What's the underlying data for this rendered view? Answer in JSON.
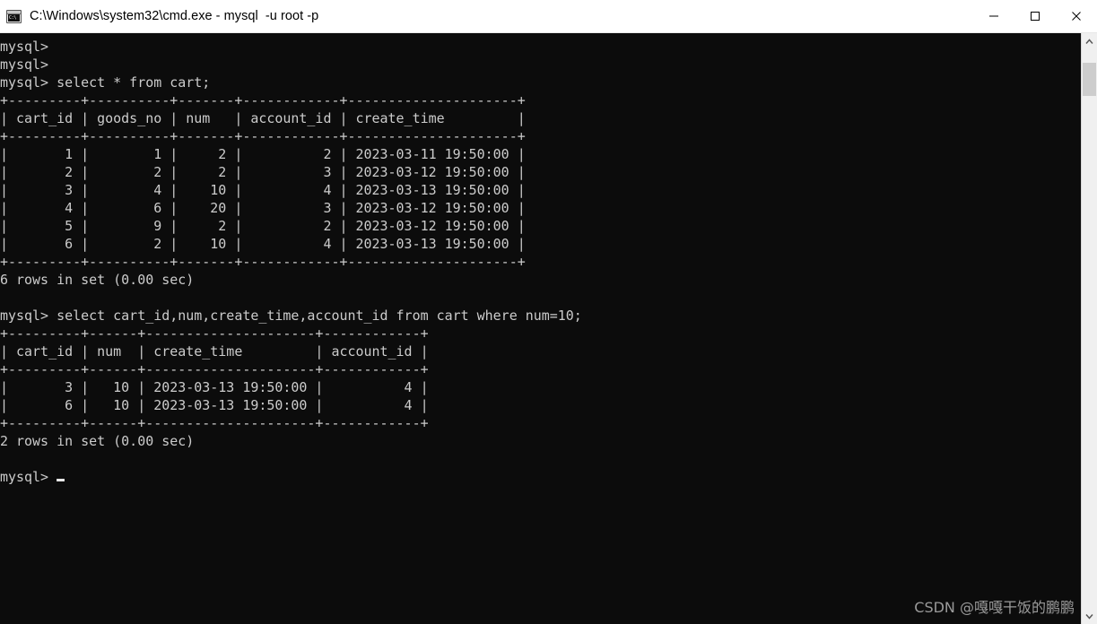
{
  "window": {
    "title": "C:\\Windows\\system32\\cmd.exe - mysql  -u root -p",
    "icon": "cmd-console-icon",
    "icon_text": "C:\\",
    "controls": {
      "minimize_label": "Minimize",
      "maximize_label": "Maximize",
      "close_label": "Close"
    }
  },
  "terminal": {
    "prompt": "mysql>",
    "background_color": "#0c0c0c",
    "text_color": "#cccccc",
    "lines": [
      "mysql>",
      "mysql>",
      "mysql> select * from cart;",
      "+---------+----------+-------+------------+---------------------+",
      "| cart_id | goods_no | num   | account_id | create_time         |",
      "+---------+----------+-------+------------+---------------------+",
      "|       1 |        1 |     2 |          2 | 2023-03-11 19:50:00 |",
      "|       2 |        2 |     2 |          3 | 2023-03-12 19:50:00 |",
      "|       3 |        4 |    10 |          4 | 2023-03-13 19:50:00 |",
      "|       4 |        6 |    20 |          3 | 2023-03-12 19:50:00 |",
      "|       5 |        9 |     2 |          2 | 2023-03-12 19:50:00 |",
      "|       6 |        2 |    10 |          4 | 2023-03-13 19:50:00 |",
      "+---------+----------+-------+------------+---------------------+",
      "6 rows in set (0.00 sec)",
      "",
      "mysql> select cart_id,num,create_time,account_id from cart where num=10;",
      "+---------+------+---------------------+------------+",
      "| cart_id | num  | create_time         | account_id |",
      "+---------+------+---------------------+------------+",
      "|       3 |   10 | 2023-03-13 19:50:00 |          4 |",
      "|       6 |   10 | 2023-03-13 19:50:00 |          4 |",
      "+---------+------+---------------------+------------+",
      "2 rows in set (0.00 sec)",
      "",
      "mysql> "
    ],
    "queries": [
      {
        "sql": "select * from cart;",
        "status": "6 rows in set (0.00 sec)",
        "columns": [
          "cart_id",
          "goods_no",
          "num",
          "account_id",
          "create_time"
        ],
        "rows": [
          [
            "1",
            "1",
            "2",
            "2",
            "2023-03-11 19:50:00"
          ],
          [
            "2",
            "2",
            "2",
            "3",
            "2023-03-12 19:50:00"
          ],
          [
            "3",
            "4",
            "10",
            "4",
            "2023-03-13 19:50:00"
          ],
          [
            "4",
            "6",
            "20",
            "3",
            "2023-03-12 19:50:00"
          ],
          [
            "5",
            "9",
            "2",
            "2",
            "2023-03-12 19:50:00"
          ],
          [
            "6",
            "2",
            "10",
            "4",
            "2023-03-13 19:50:00"
          ]
        ]
      },
      {
        "sql": "select cart_id,num,create_time,account_id from cart where num=10;",
        "status": "2 rows in set (0.00 sec)",
        "columns": [
          "cart_id",
          "num",
          "create_time",
          "account_id"
        ],
        "rows": [
          [
            "3",
            "10",
            "2023-03-13 19:50:00",
            "4"
          ],
          [
            "6",
            "10",
            "2023-03-13 19:50:00",
            "4"
          ]
        ]
      }
    ]
  },
  "scrollbar": {
    "up_arrow": "chevron-up-icon",
    "down_arrow": "chevron-down-icon",
    "thumb_label": "scrollbar-thumb"
  },
  "watermark": {
    "text": "CSDN @嘎嘎干饭的鹏鹏"
  }
}
